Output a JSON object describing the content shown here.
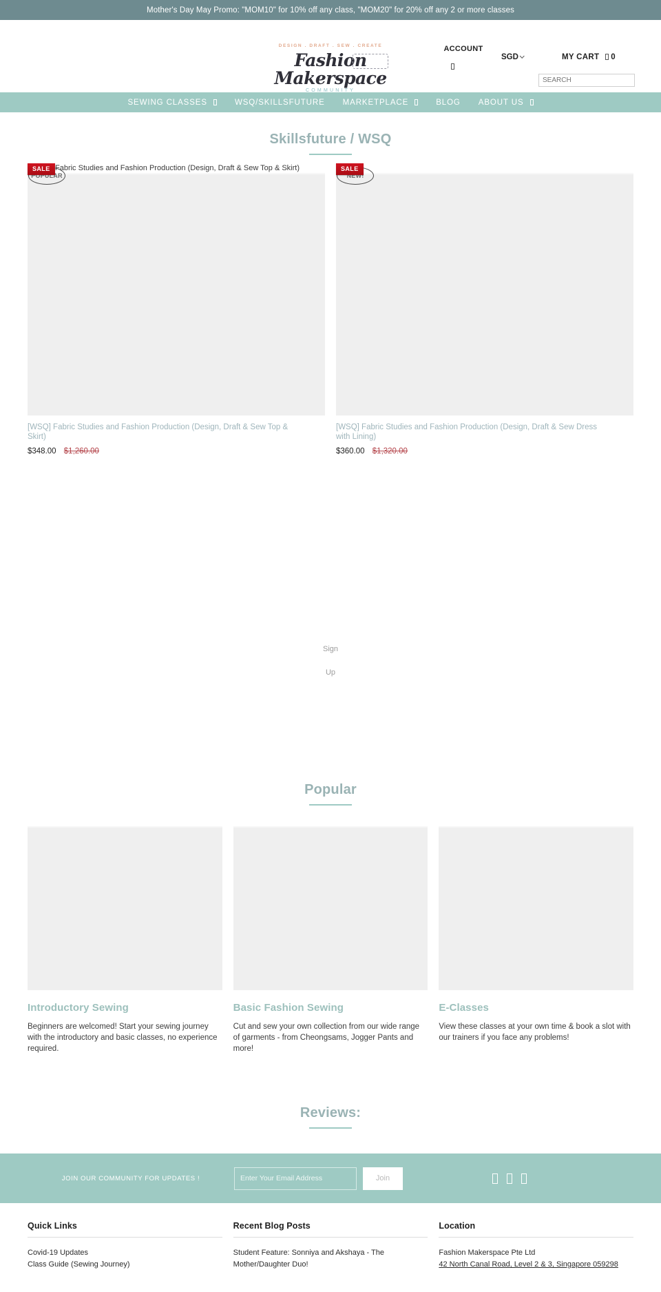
{
  "promo": {
    "text": "Mother's Day May Promo: \"MOM10\" for 10% off any class, \"MOM20\" for 20% off any 2 or more classes"
  },
  "header": {
    "logo": {
      "arc_text": "DESIGN . DRAFT . SEW . CREATE",
      "name": "Fashion Makerspace",
      "sub": "COMMUNITY"
    },
    "account_label": "ACCOUNT",
    "account_icon": "user-icon",
    "currency": "SGD",
    "currency_chevron": "chevron-down-icon",
    "cart_label": "MY CART",
    "cart_icon": "cart-icon",
    "cart_count": "0",
    "search_placeholder": "SEARCH",
    "search_value": ""
  },
  "nav": {
    "items": [
      {
        "label": "SEWING CLASSES",
        "has_caret": true,
        "caret_icon": "chevron-down-icon"
      },
      {
        "label": "WSQ/SKILLSFUTURE",
        "has_caret": false
      },
      {
        "label": "MARKETPLACE",
        "has_caret": true,
        "caret_icon": "chevron-down-icon"
      },
      {
        "label": "BLOG",
        "has_caret": false
      },
      {
        "label": "ABOUT US",
        "has_caret": true,
        "caret_icon": "chevron-down-icon"
      }
    ]
  },
  "skillsfuture": {
    "heading": "Skillsfuture / WSQ",
    "products": [
      {
        "alt_text": "Fabric Studies and Fashion Production (Design, Draft & Sew Top & Skirt)",
        "sale_badge": "SALE",
        "tag_badge": "POPULAR",
        "title": "[WSQ] Fabric Studies and Fashion Production (Design, Draft & Sew Top & Skirt)",
        "price": "$348.00",
        "price_old": "$1,260.00"
      },
      {
        "alt_text": "",
        "sale_badge": "SALE",
        "tag_badge": "NEW!",
        "title": "[WSQ] Fabric Studies and Fashion Production (Design, Draft & Sew Dress with Lining)",
        "price": "$360.00",
        "price_old": "$1,320.00"
      }
    ]
  },
  "stray_signup": {
    "line1": "Sign",
    "line2": "Up"
  },
  "popular": {
    "heading": "Popular",
    "cards": [
      {
        "title": "Introductory Sewing",
        "body": "Beginners are welcomed! Start your sewing journey with the introductory and basic classes, no experience required."
      },
      {
        "title": "Basic Fashion Sewing",
        "body": "Cut and sew your own collection from our wide range of garments - from Cheongsams, Jogger Pants and more!"
      },
      {
        "title": "E-Classes",
        "body": "View these classes at your own time & book a slot with our trainers if you face any problems!"
      }
    ]
  },
  "reviews": {
    "heading": "Reviews:"
  },
  "newsletter": {
    "text": "JOIN OUR COMMUNITY FOR UPDATES !",
    "placeholder": "Enter Your Email Address",
    "value": "",
    "join_label": "Join",
    "socials": [
      "facebook-icon",
      "instagram-icon",
      "youtube-icon"
    ]
  },
  "footer": {
    "columns": [
      {
        "title": "Quick Links",
        "items": [
          {
            "text": "Covid-19 Updates",
            "underline": false
          },
          {
            "text": "Class Guide (Sewing Journey)",
            "underline": false
          }
        ]
      },
      {
        "title": "Recent Blog Posts",
        "items": [
          {
            "text": "Student Feature: Sonniya and Akshaya - The",
            "underline": false
          },
          {
            "text": "Mother/Daughter Duo!",
            "underline": false
          }
        ]
      },
      {
        "title": "Location",
        "items": [
          {
            "text": "Fashion Makerspace Pte Ltd",
            "underline": false
          },
          {
            "text": "42 North Canal Road, Level 2 & 3, Singapore 059298",
            "underline": true
          }
        ]
      }
    ]
  },
  "colors": {
    "promo_bg": "#6e8b90",
    "nav_bg": "#9ecac3",
    "heading": "#9ab3b4",
    "sale_red": "#cf1420",
    "price_old": "#b4444a"
  }
}
